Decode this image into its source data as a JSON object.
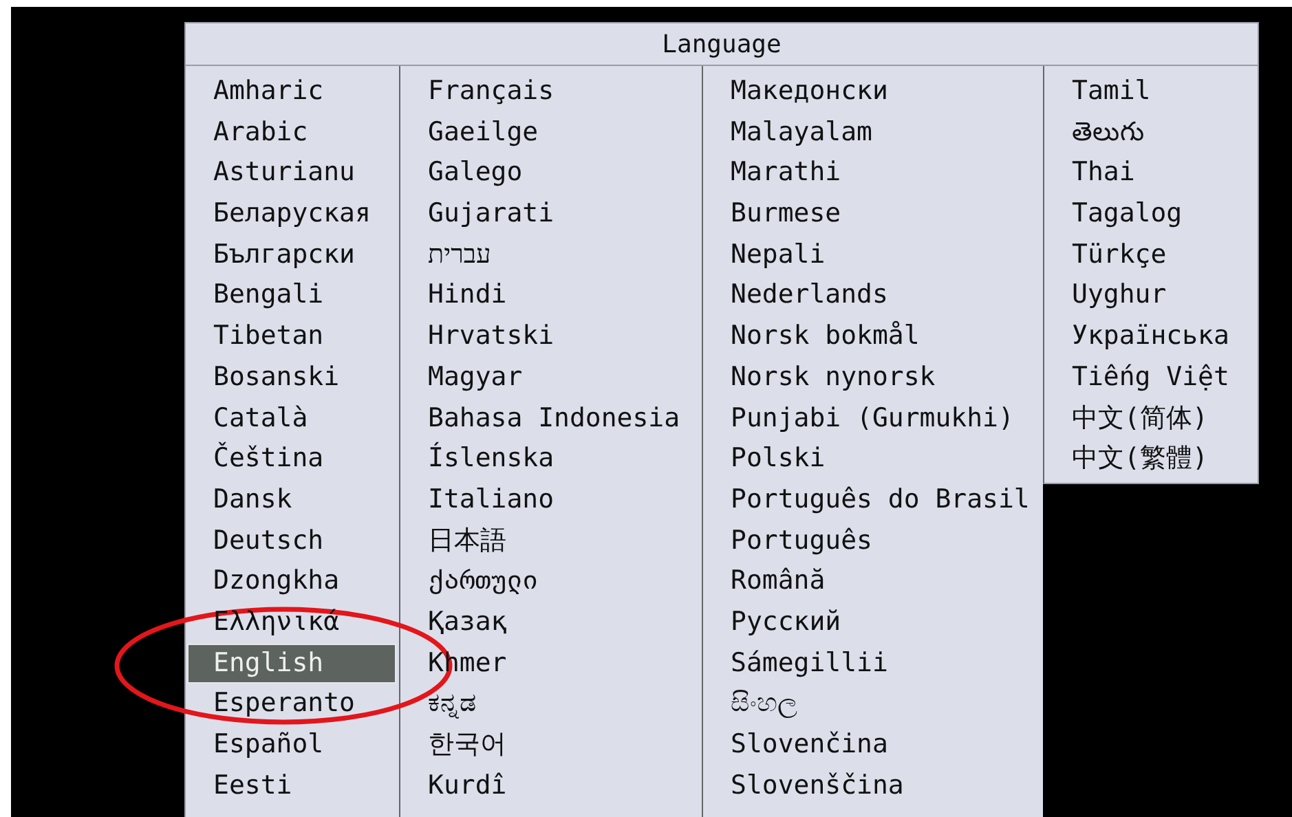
{
  "dialog": {
    "title": "Language",
    "columns": [
      {
        "items": [
          {
            "label": "Amharic",
            "selected": false
          },
          {
            "label": "Arabic",
            "selected": false
          },
          {
            "label": "Asturianu",
            "selected": false
          },
          {
            "label": "Беларуская",
            "selected": false
          },
          {
            "label": "Български",
            "selected": false
          },
          {
            "label": "Bengali",
            "selected": false
          },
          {
            "label": "Tibetan",
            "selected": false
          },
          {
            "label": "Bosanski",
            "selected": false
          },
          {
            "label": "Català",
            "selected": false
          },
          {
            "label": "Čeština",
            "selected": false
          },
          {
            "label": "Dansk",
            "selected": false
          },
          {
            "label": "Deutsch",
            "selected": false
          },
          {
            "label": "Dzongkha",
            "selected": false
          },
          {
            "label": "Ελληνικά",
            "selected": false
          },
          {
            "label": "English",
            "selected": true
          },
          {
            "label": "Esperanto",
            "selected": false
          },
          {
            "label": "Español",
            "selected": false
          },
          {
            "label": "Eesti",
            "selected": false
          }
        ]
      },
      {
        "items": [
          {
            "label": "Français",
            "selected": false
          },
          {
            "label": "Gaeilge",
            "selected": false
          },
          {
            "label": "Galego",
            "selected": false
          },
          {
            "label": "Gujarati",
            "selected": false
          },
          {
            "label": "עברית",
            "selected": false
          },
          {
            "label": "Hindi",
            "selected": false
          },
          {
            "label": "Hrvatski",
            "selected": false
          },
          {
            "label": "Magyar",
            "selected": false
          },
          {
            "label": "Bahasa Indonesia",
            "selected": false
          },
          {
            "label": "Íslenska",
            "selected": false
          },
          {
            "label": "Italiano",
            "selected": false
          },
          {
            "label": "日本語",
            "selected": false
          },
          {
            "label": "ქართული",
            "selected": false
          },
          {
            "label": "Қазақ",
            "selected": false
          },
          {
            "label": "Khmer",
            "selected": false
          },
          {
            "label": "ಕನ್ನಡ",
            "selected": false
          },
          {
            "label": "한국어",
            "selected": false
          },
          {
            "label": "Kurdî",
            "selected": false
          }
        ]
      },
      {
        "items": [
          {
            "label": "Македонски",
            "selected": false
          },
          {
            "label": "Malayalam",
            "selected": false
          },
          {
            "label": "Marathi",
            "selected": false
          },
          {
            "label": "Burmese",
            "selected": false
          },
          {
            "label": "Nepali",
            "selected": false
          },
          {
            "label": "Nederlands",
            "selected": false
          },
          {
            "label": "Norsk bokmål",
            "selected": false
          },
          {
            "label": "Norsk nynorsk",
            "selected": false
          },
          {
            "label": "Punjabi (Gurmukhi)",
            "selected": false
          },
          {
            "label": "Polski",
            "selected": false
          },
          {
            "label": "Português do Brasil",
            "selected": false
          },
          {
            "label": "Português",
            "selected": false
          },
          {
            "label": "Română",
            "selected": false
          },
          {
            "label": "Русский",
            "selected": false
          },
          {
            "label": "Sámegillii",
            "selected": false
          },
          {
            "label": "සිංහල",
            "selected": false
          },
          {
            "label": "Slovenčina",
            "selected": false
          },
          {
            "label": "Slovenščina",
            "selected": false
          }
        ]
      },
      {
        "items": [
          {
            "label": "Tamil",
            "selected": false
          },
          {
            "label": "తెలుగు",
            "selected": false
          },
          {
            "label": "Thai",
            "selected": false
          },
          {
            "label": "Tagalog",
            "selected": false
          },
          {
            "label": "Türkçe",
            "selected": false
          },
          {
            "label": "Uyghur",
            "selected": false
          },
          {
            "label": "Українська",
            "selected": false
          },
          {
            "label": "Tiếng Việt",
            "selected": false
          },
          {
            "label": "中文(简体)",
            "selected": false
          },
          {
            "label": "中文(繁體)",
            "selected": false
          }
        ]
      }
    ]
  }
}
